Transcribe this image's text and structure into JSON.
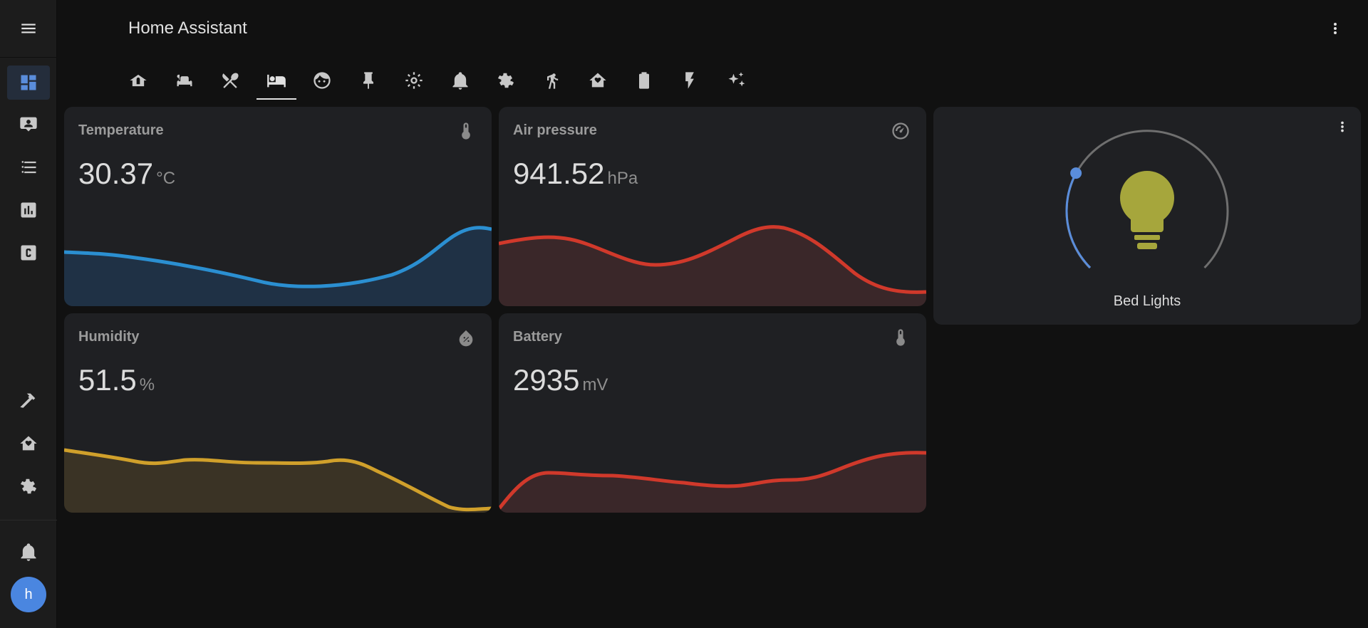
{
  "app": {
    "title": "Home Assistant",
    "avatar_initial": "h"
  },
  "sidebar": {
    "items": [
      {
        "name": "overview",
        "icon": "dashboard-icon",
        "active": true
      },
      {
        "name": "map",
        "icon": "account-box-icon"
      },
      {
        "name": "logbook",
        "icon": "format-list-icon"
      },
      {
        "name": "history",
        "icon": "chart-box-icon"
      },
      {
        "name": "custom",
        "icon": "alpha-c-box-icon"
      },
      {
        "name": "developer-tools",
        "icon": "hammer-icon"
      },
      {
        "name": "hacs",
        "icon": "home-heart-icon"
      },
      {
        "name": "settings",
        "icon": "gear-icon"
      },
      {
        "name": "notifications",
        "icon": "bell-icon"
      }
    ]
  },
  "tabs": [
    {
      "icon": "home-roof-icon"
    },
    {
      "icon": "sofa-icon"
    },
    {
      "icon": "silverware-icon"
    },
    {
      "icon": "bed-icon",
      "active": true
    },
    {
      "icon": "face-icon"
    },
    {
      "icon": "pin-icon"
    },
    {
      "icon": "brightness-icon"
    },
    {
      "icon": "bell-icon"
    },
    {
      "icon": "cog-icon"
    },
    {
      "icon": "walk-icon"
    },
    {
      "icon": "home-heart-icon"
    },
    {
      "icon": "battery-icon"
    },
    {
      "icon": "flash-icon"
    },
    {
      "icon": "sparkles-icon"
    }
  ],
  "cards": {
    "temperature": {
      "title": "Temperature",
      "value": "30.37",
      "unit": "°C",
      "icon": "thermometer-icon",
      "color": "#2b8fd1"
    },
    "air_pressure": {
      "title": "Air pressure",
      "value": "941.52",
      "unit": "hPa",
      "icon": "gauge-icon",
      "color": "#d0392b"
    },
    "humidity": {
      "title": "Humidity",
      "value": "51.5",
      "unit": "%",
      "icon": "water-percent-icon",
      "color": "#d0a02b"
    },
    "battery": {
      "title": "Battery",
      "value": "2935",
      "unit": "mV",
      "icon": "thermometer-icon",
      "color": "#d0392b"
    }
  },
  "light": {
    "name": "Bed Lights",
    "brightness_fraction": 0.27,
    "bulb_color": "#a6a63c",
    "accent": "#5a8ddb"
  }
}
